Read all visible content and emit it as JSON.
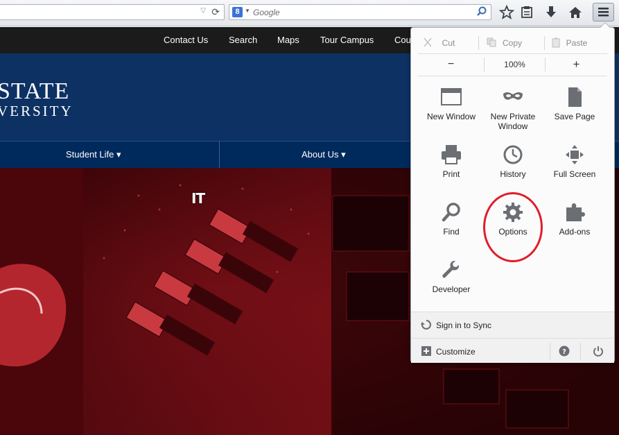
{
  "browser": {
    "search_placeholder": "Google",
    "search_engine_letter": "8"
  },
  "site": {
    "top_nav": [
      "Contact Us",
      "Search",
      "Maps",
      "Tour Campus",
      "Cou"
    ],
    "logo_line1": "STATE",
    "logo_line2": "VERSITY",
    "main_nav": [
      "Student Life",
      "About Us"
    ],
    "hero_text": "IT"
  },
  "menu": {
    "edit": {
      "cut": "Cut",
      "copy": "Copy",
      "paste": "Paste"
    },
    "zoom": {
      "minus": "−",
      "level": "100%",
      "plus": "+"
    },
    "tiles": [
      {
        "label": "New Window",
        "icon": "window-icon"
      },
      {
        "label": "New Private Window",
        "icon": "mask-icon"
      },
      {
        "label": "Save Page",
        "icon": "page-icon"
      },
      {
        "label": "Print",
        "icon": "printer-icon"
      },
      {
        "label": "History",
        "icon": "clock-icon"
      },
      {
        "label": "Full Screen",
        "icon": "fullscreen-icon"
      },
      {
        "label": "Find",
        "icon": "magnifier-icon"
      },
      {
        "label": "Options",
        "icon": "gear-icon"
      },
      {
        "label": "Add-ons",
        "icon": "puzzle-icon"
      },
      {
        "label": "Developer",
        "icon": "wrench-icon"
      }
    ],
    "sync_label": "Sign in to Sync",
    "customize_label": "Customize"
  },
  "colors": {
    "annotation": "#e21c2a",
    "banner": "#0d3163",
    "icon_gray": "#6b6e73"
  }
}
